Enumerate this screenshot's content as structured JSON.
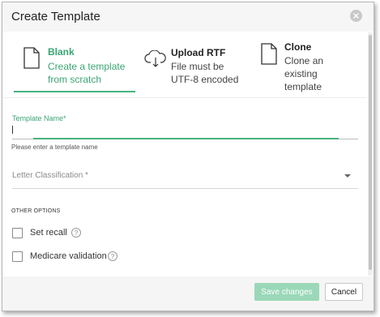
{
  "dialog": {
    "title": "Create Template",
    "close_icon": "close-icon"
  },
  "options": [
    {
      "title": "Blank",
      "desc": "Create a template from scratch",
      "icon": "document-icon",
      "selected": true,
      "accent": "#3aa574"
    },
    {
      "title": "Upload RTF",
      "desc": "File must be UTF-8 encoded",
      "icon": "cloud-upload-icon",
      "selected": false
    },
    {
      "title": "Clone",
      "desc": "Clone an existing template",
      "icon": "document-icon",
      "selected": false
    }
  ],
  "template_name": {
    "label": "Template Name",
    "required_mark": "*",
    "value": "",
    "helper": "Please enter a template name"
  },
  "letter_classification": {
    "label": "Letter Classification",
    "required_mark": "*",
    "value": ""
  },
  "other_options": {
    "title": "OTHER OPTIONS",
    "items": [
      {
        "label": "Set recall",
        "checked": false,
        "help": "?"
      },
      {
        "label": "Medicare validation",
        "checked": false,
        "help": "?"
      }
    ]
  },
  "footer": {
    "save_label": "Save changes",
    "cancel_label": "Cancel"
  },
  "colors": {
    "accent": "#47b27f",
    "save_disabled": "#9ad8b8"
  }
}
